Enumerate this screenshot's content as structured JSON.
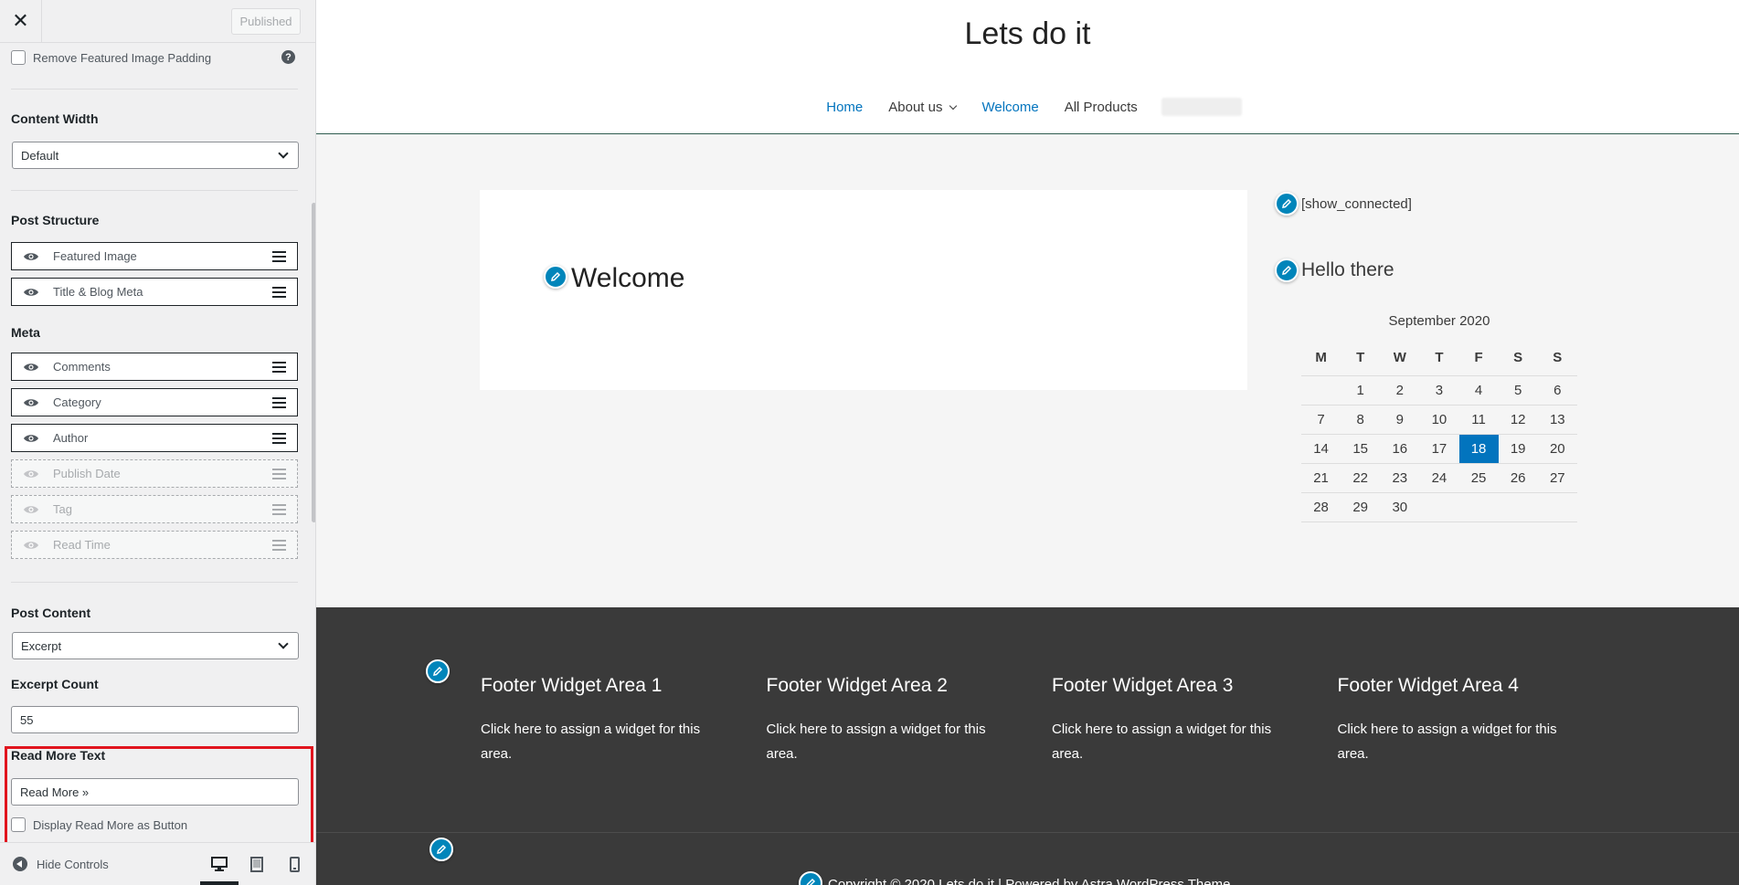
{
  "customizer": {
    "published_label": "Published",
    "remove_featured_padding_label": "Remove Featured Image Padding",
    "content_width": {
      "title": "Content Width",
      "value": "Default"
    },
    "post_structure": {
      "title": "Post Structure",
      "items": [
        {
          "label": "Featured Image",
          "enabled": true
        },
        {
          "label": "Title & Blog Meta",
          "enabled": true
        }
      ]
    },
    "meta": {
      "title": "Meta",
      "items": [
        {
          "label": "Comments",
          "enabled": true
        },
        {
          "label": "Category",
          "enabled": true
        },
        {
          "label": "Author",
          "enabled": true
        },
        {
          "label": "Publish Date",
          "enabled": false
        },
        {
          "label": "Tag",
          "enabled": false
        },
        {
          "label": "Read Time",
          "enabled": false
        }
      ]
    },
    "post_content": {
      "title": "Post Content",
      "value": "Excerpt"
    },
    "excerpt_count": {
      "title": "Excerpt Count",
      "value": "55"
    },
    "read_more": {
      "title": "Read More Text",
      "value": "Read More »",
      "button_label": "Display Read More as Button"
    },
    "hide_controls_label": "Hide Controls",
    "highlight_color": "#e1151e"
  },
  "site": {
    "title": "Lets do it",
    "nav": [
      "Home",
      "About us",
      "Welcome",
      "All Products"
    ],
    "post_title": "Welcome",
    "sidebar": {
      "shortcode": "[show_connected]",
      "widget_title": "Hello there",
      "calendar": {
        "caption": "September 2020",
        "days": [
          "M",
          "T",
          "W",
          "T",
          "F",
          "S",
          "S"
        ],
        "weeks": [
          [
            "",
            "1",
            "2",
            "3",
            "4",
            "5",
            "6"
          ],
          [
            "7",
            "8",
            "9",
            "10",
            "11",
            "12",
            "13"
          ],
          [
            "14",
            "15",
            "16",
            "17",
            "18",
            "19",
            "20"
          ],
          [
            "21",
            "22",
            "23",
            "24",
            "25",
            "26",
            "27"
          ],
          [
            "28",
            "29",
            "30",
            "",
            "",
            "",
            ""
          ]
        ],
        "today": "18"
      }
    },
    "footer_widgets": [
      {
        "title": "Footer Widget Area 1",
        "text": "Click here to assign a widget for this area."
      },
      {
        "title": "Footer Widget Area 2",
        "text": "Click here to assign a widget for this area."
      },
      {
        "title": "Footer Widget Area 3",
        "text": "Click here to assign a widget for this area."
      },
      {
        "title": "Footer Widget Area 4",
        "text": "Click here to assign a widget for this area."
      }
    ],
    "copyright": "Copyright © 2020 Lets do it | Powered by Astra WordPress Theme",
    "accent_color": "#0274be",
    "footer_color": "#3a3a3a"
  }
}
